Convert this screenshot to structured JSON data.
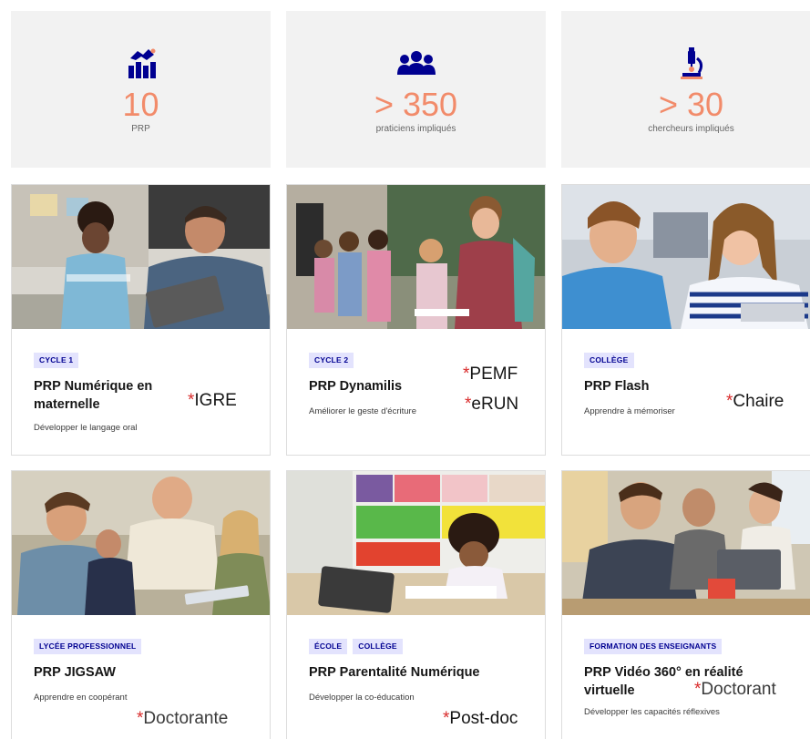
{
  "stats": [
    {
      "icon": "handshake-chart-icon",
      "value": "10",
      "caption": "PRP"
    },
    {
      "icon": "people-group-icon",
      "value": "> 350",
      "caption": "praticiens impliqués"
    },
    {
      "icon": "microscope-icon",
      "value": "> 30",
      "caption": "chercheurs impliqués"
    }
  ],
  "cards": [
    {
      "tags": [
        "CYCLE 1"
      ],
      "title": "PRP Numérique en maternelle",
      "desc": "Développer le langage oral",
      "image": "child-and-teacher-with-tablet-photo"
    },
    {
      "tags": [
        "CYCLE 2"
      ],
      "title": "PRP Dynamilis",
      "desc": "Améliorer le geste d'écriture",
      "image": "pupils-reading-with-tablets-photo"
    },
    {
      "tags": [
        "COLLÈGE"
      ],
      "title": "PRP Flash",
      "desc": "Apprendre à mémoriser",
      "image": "two-students-with-tablet-photo"
    },
    {
      "tags": [
        "LYCÉE PROFESSIONNEL"
      ],
      "title": "PRP JIGSAW",
      "desc": "Apprendre en coopérant",
      "image": "teacher-helping-students-photo"
    },
    {
      "tags": [
        "ÉCOLE",
        "COLLÈGE"
      ],
      "title": "PRP Parentalité Numérique",
      "desc": "Développer la co-éducation",
      "image": "child-drawing-at-desk-photo"
    },
    {
      "tags": [
        "FORMATION DES ENSEIGNANTS"
      ],
      "title": "PRP Vidéo 360° en réalité virtuelle",
      "desc": "Développer les capacités réflexives",
      "image": "adults-working-on-laptop-photo"
    }
  ],
  "annotations": {
    "asterisk": "*",
    "igre": "IGRE",
    "pemf": "PEMF",
    "erun": "eRUN",
    "chaire": "Chaire",
    "doctorante": "Doctorante",
    "postdoc": "Post-doc",
    "doctorant": "Doctorant"
  },
  "colors": {
    "stat_value": "#f28b6a",
    "icon_blue": "#000091",
    "tag_bg": "#e3e3fd",
    "stat_bg": "#f2f2f2",
    "asterisk": "#d92b2b"
  }
}
